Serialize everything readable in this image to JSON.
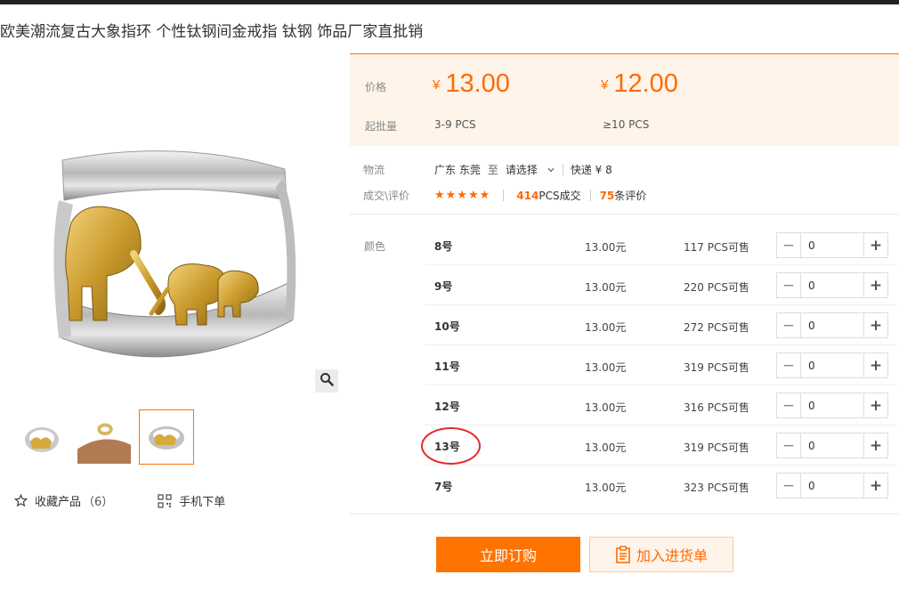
{
  "product": {
    "title": "欧美潮流复古大象指环 个性钛钢间金戒指 钛钢 饰品厂家直批销"
  },
  "gallery": {
    "zoom_icon": "magnifier-icon",
    "thumb_count": 3
  },
  "left_actions": {
    "favorite_label": "收藏产品",
    "favorite_count": "（6）",
    "mobile_label": "手机下单"
  },
  "pricing": {
    "price_label": "价格",
    "moq_label": "起批量",
    "currency": "¥",
    "tiers": [
      {
        "price": "13.00",
        "qty": "3-9  PCS"
      },
      {
        "price": "12.00",
        "qty": "≥10  PCS"
      }
    ]
  },
  "logistics": {
    "label": "物流",
    "from": "广东 东莞",
    "to_word": "至",
    "destination_placeholder": "请选择",
    "shipping": "快递 ¥ 8"
  },
  "reviews": {
    "label": "成交\\评价",
    "stars": "★★★★★",
    "sold_count": "414",
    "sold_suffix": "PCS成交",
    "review_count": "75",
    "review_suffix": "条评价"
  },
  "sku": {
    "color_label": "颜色",
    "rows": [
      {
        "name": "8号",
        "price": "13.00元",
        "stock": "117 PCS可售",
        "qty": "0"
      },
      {
        "name": "9号",
        "price": "13.00元",
        "stock": "220 PCS可售",
        "qty": "0"
      },
      {
        "name": "10号",
        "price": "13.00元",
        "stock": "272 PCS可售",
        "qty": "0"
      },
      {
        "name": "11号",
        "price": "13.00元",
        "stock": "319 PCS可售",
        "qty": "0"
      },
      {
        "name": "12号",
        "price": "13.00元",
        "stock": "316 PCS可售",
        "qty": "0"
      },
      {
        "name": "13号",
        "price": "13.00元",
        "stock": "319 PCS可售",
        "qty": "0"
      },
      {
        "name": "7号",
        "price": "13.00元",
        "stock": "323 PCS可售",
        "qty": "0"
      }
    ],
    "minus": "−",
    "plus": "+"
  },
  "actions": {
    "order_label": "立即订购",
    "cart_label": "加入进货单"
  },
  "colors": {
    "accent": "#ff7300",
    "price": "#ff6a00",
    "highlight_circle": "#e52a2a"
  }
}
